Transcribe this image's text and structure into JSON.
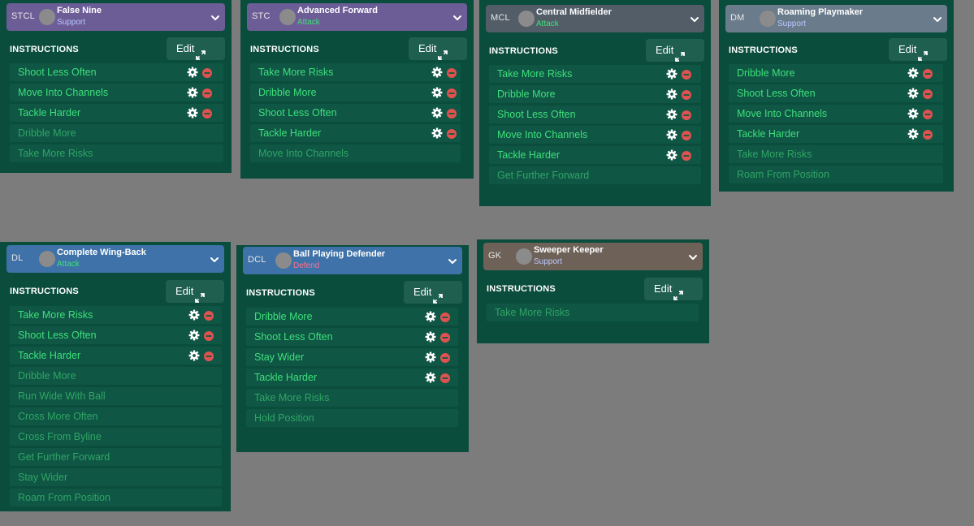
{
  "instructions_heading": "INSTRUCTIONS",
  "edit_label": "Edit",
  "colors": {
    "panel": "#0a4d3c",
    "row": "#0f5645",
    "active_text": "#3ee07a",
    "inactive_text": "#2fa564",
    "remove": "#e0524f",
    "background": "#7c7c7c"
  },
  "players": [
    {
      "position": "STCL",
      "role": "False Nine",
      "duty": "Support",
      "instructions": [
        {
          "label": "Shoot Less Often",
          "active": true
        },
        {
          "label": "Move Into Channels",
          "active": true
        },
        {
          "label": "Tackle Harder",
          "active": true
        },
        {
          "label": "Dribble More",
          "active": false
        },
        {
          "label": "Take More Risks",
          "active": false
        }
      ]
    },
    {
      "position": "STC",
      "role": "Advanced Forward",
      "duty": "Attack",
      "instructions": [
        {
          "label": "Take More Risks",
          "active": true
        },
        {
          "label": "Dribble More",
          "active": true
        },
        {
          "label": "Shoot Less Often",
          "active": true
        },
        {
          "label": "Tackle Harder",
          "active": true
        },
        {
          "label": "Move Into Channels",
          "active": false
        }
      ]
    },
    {
      "position": "MCL",
      "role": "Central Midfielder",
      "duty": "Attack",
      "instructions": [
        {
          "label": "Take More Risks",
          "active": true
        },
        {
          "label": "Dribble More",
          "active": true
        },
        {
          "label": "Shoot Less Often",
          "active": true
        },
        {
          "label": "Move Into Channels",
          "active": true
        },
        {
          "label": "Tackle Harder",
          "active": true
        },
        {
          "label": "Get Further Forward",
          "active": false
        }
      ]
    },
    {
      "position": "DM",
      "role": "Roaming Playmaker",
      "duty": "Support",
      "instructions": [
        {
          "label": "Dribble More",
          "active": true
        },
        {
          "label": "Shoot Less Often",
          "active": true
        },
        {
          "label": "Move Into Channels",
          "active": true
        },
        {
          "label": "Tackle Harder",
          "active": true
        },
        {
          "label": "Take More Risks",
          "active": false
        },
        {
          "label": "Roam From Position",
          "active": false
        }
      ]
    },
    {
      "position": "DL",
      "role": "Complete Wing-Back",
      "duty": "Attack",
      "instructions": [
        {
          "label": "Take More Risks",
          "active": true
        },
        {
          "label": "Shoot Less Often",
          "active": true
        },
        {
          "label": "Tackle Harder",
          "active": true
        },
        {
          "label": "Dribble More",
          "active": false
        },
        {
          "label": "Run Wide With Ball",
          "active": false
        },
        {
          "label": "Cross More Often",
          "active": false
        },
        {
          "label": "Cross From Byline",
          "active": false
        },
        {
          "label": "Get Further Forward",
          "active": false
        },
        {
          "label": "Stay Wider",
          "active": false
        },
        {
          "label": "Roam From Position",
          "active": false
        }
      ]
    },
    {
      "position": "DCL",
      "role": "Ball Playing Defender",
      "duty": "Defend",
      "instructions": [
        {
          "label": "Dribble More",
          "active": true
        },
        {
          "label": "Shoot Less Often",
          "active": true
        },
        {
          "label": "Stay Wider",
          "active": true
        },
        {
          "label": "Tackle Harder",
          "active": true
        },
        {
          "label": "Take More Risks",
          "active": false
        },
        {
          "label": "Hold Position",
          "active": false
        }
      ]
    },
    {
      "position": "GK",
      "role": "Sweeper Keeper",
      "duty": "Support",
      "instructions": [
        {
          "label": "Take More Risks",
          "active": false
        }
      ]
    }
  ]
}
